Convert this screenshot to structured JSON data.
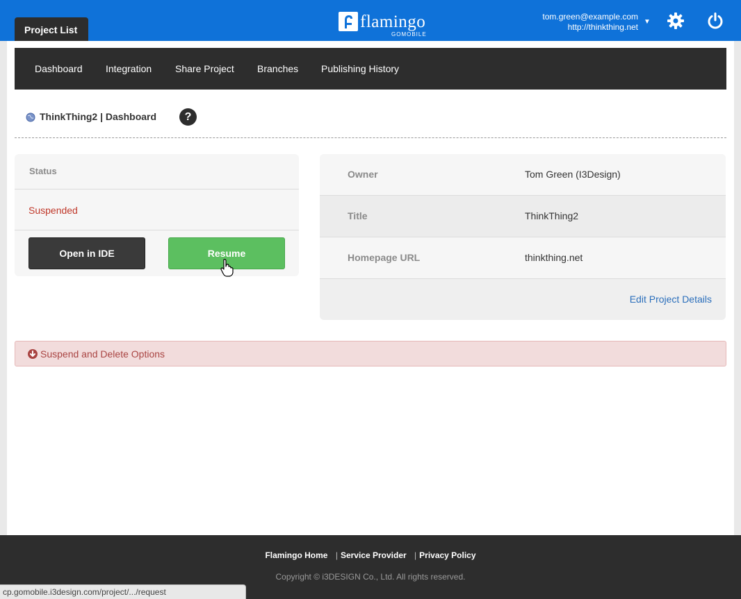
{
  "header": {
    "tab_label": "Project List",
    "logo_text": "flamingo",
    "logo_sub": "GOMOBILE",
    "account_email": "tom.green@example.com",
    "account_url": "http://thinkthing.net",
    "icons": [
      "gear-icon",
      "power-icon",
      "chevron-down-icon"
    ],
    "bar_color": "#0f72d9"
  },
  "nav": {
    "items": [
      "Dashboard",
      "Integration",
      "Share Project",
      "Branches",
      "Publishing History"
    ]
  },
  "page": {
    "title": "ThinkThing2 | Dashboard",
    "help": "?"
  },
  "status": {
    "label": "Status",
    "value": "Suspended",
    "value_color": "#c0392b",
    "open_ide_label": "Open in IDE",
    "resume_label": "Resume"
  },
  "details": {
    "rows": [
      {
        "label": "Owner",
        "value": "Tom Green (I3Design)"
      },
      {
        "label": "Title",
        "value": "ThinkThing2"
      },
      {
        "label": "Homepage URL",
        "value": "thinkthing.net"
      }
    ],
    "edit_label": "Edit Project Details"
  },
  "danger": {
    "label": "Suspend and Delete Options"
  },
  "footer": {
    "links": [
      "Flamingo Home",
      "Service Provider",
      "Privacy Policy"
    ],
    "copyright": "Copyright © i3DESIGN Co., Ltd. All rights reserved."
  },
  "browser_status": {
    "url": "cp.gomobile.i3design.com/project/.../request"
  }
}
